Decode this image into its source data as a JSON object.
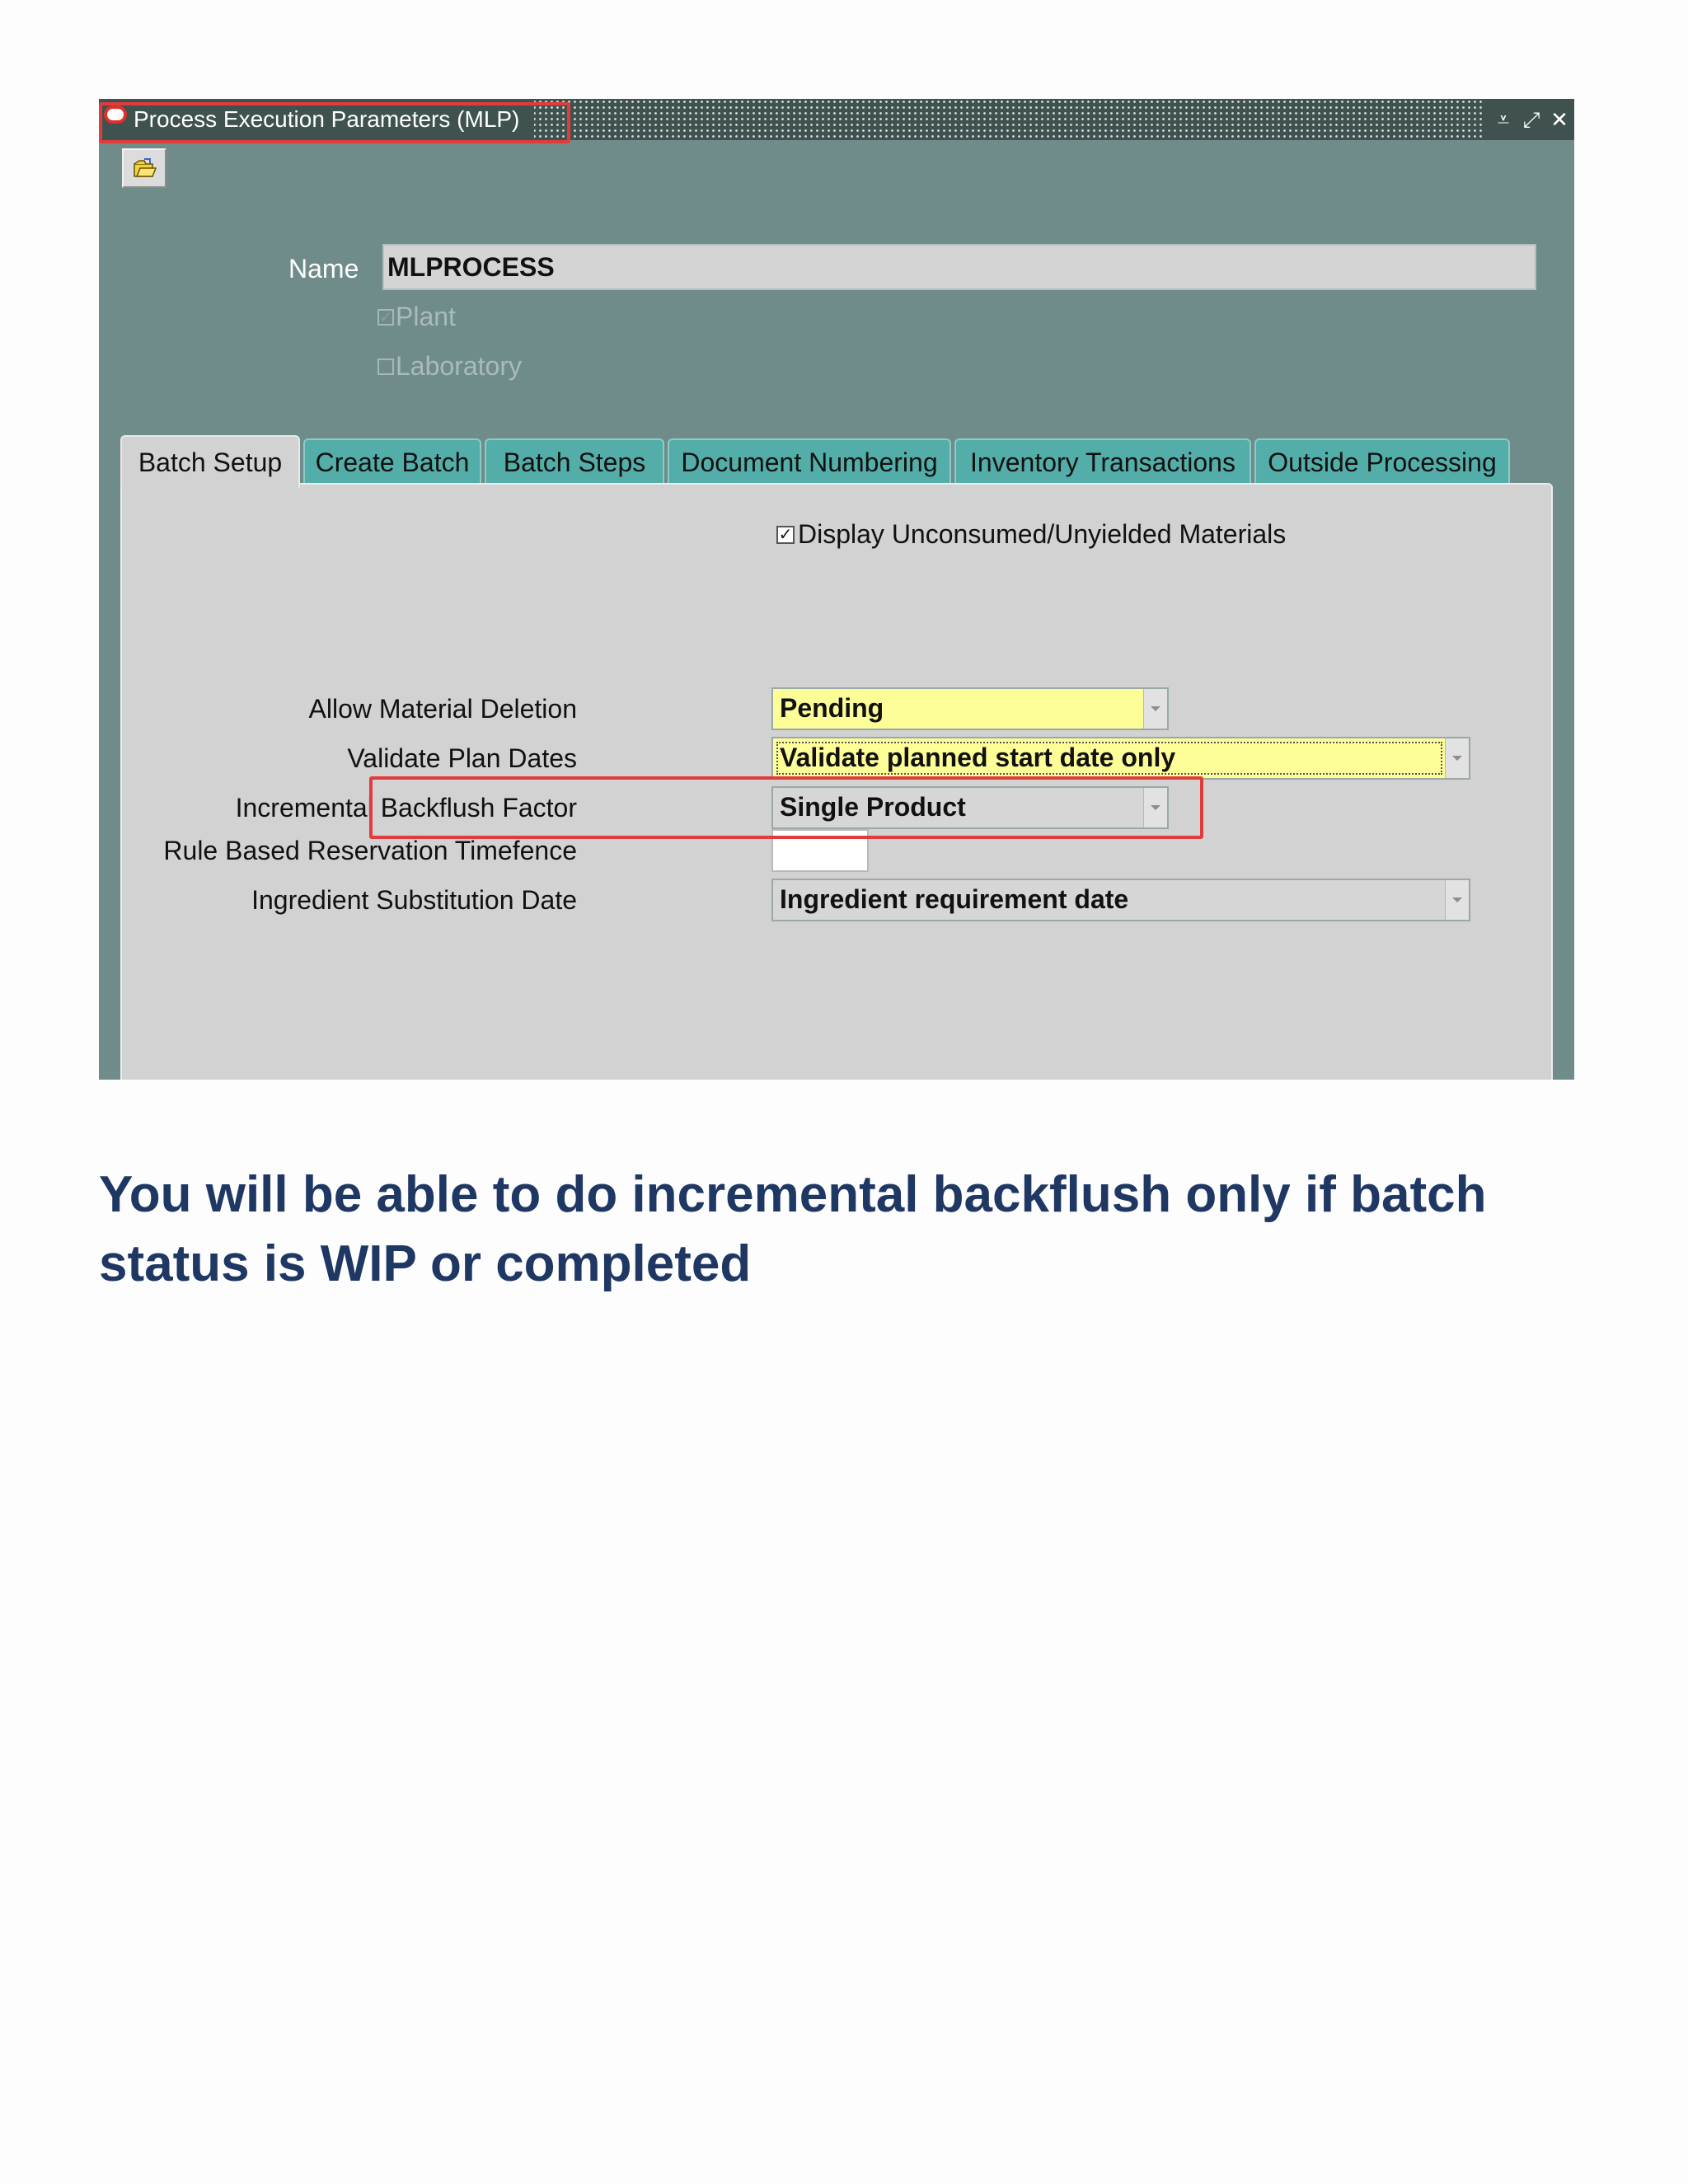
{
  "window": {
    "title": "Process Execution Parameters (MLP)",
    "controls": {
      "minimize": "⩡",
      "maximize": "⤢",
      "close": "✕"
    }
  },
  "header": {
    "name_label": "Name",
    "name_value": "MLPROCESS",
    "plant_label": "Plant",
    "plant_checked": true,
    "laboratory_label": "Laboratory",
    "laboratory_checked": false
  },
  "tabs": [
    {
      "label": "Batch Setup",
      "active": true
    },
    {
      "label": "Create Batch",
      "active": false
    },
    {
      "label": "Batch Steps",
      "active": false
    },
    {
      "label": "Document Numbering",
      "active": false
    },
    {
      "label": "Inventory Transactions",
      "active": false
    },
    {
      "label": "Outside Processing",
      "active": false
    }
  ],
  "batch_setup": {
    "display_unconsumed_label": "Display Unconsumed/Unyielded Materials",
    "display_unconsumed_checked": true,
    "fields": [
      {
        "label": "Allow Material Deletion",
        "value": "Pending"
      },
      {
        "label": "Validate Plan Dates",
        "value": "Validate planned start date only"
      },
      {
        "label": "Incremental Backflush Factor",
        "value": "Single Product"
      },
      {
        "label": "Rule Based Reservation Timefence",
        "value": ""
      },
      {
        "label": "Ingredient Substitution Date",
        "value": "Ingredient requirement date"
      }
    ]
  },
  "caption": "You will be able to do incremental backflush only if batch status is WIP or completed",
  "colors": {
    "window_bg": "#6f8c8a",
    "tab_bg": "#53ada8",
    "highlight_yellow": "#fefe98",
    "callout_red": "#e03c3c",
    "caption_blue": "#1f3763"
  }
}
